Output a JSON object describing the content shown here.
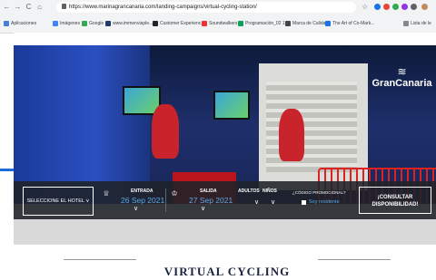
{
  "browser": {
    "url": "https://www.marinagrancanaria.com/landing-campaigns/virtual-cycling-station/",
    "nav_back": "←",
    "nav_forward": "→",
    "nav_reload": "C",
    "nav_home": "⌂",
    "star": "☆"
  },
  "bookmarks": [
    {
      "label": "Aplicaciones",
      "color": "#4a7fd8"
    },
    {
      "label": "Imágenes",
      "color": "#4285f4"
    },
    {
      "label": "Google",
      "color": "#34a853"
    },
    {
      "label": "www.immenviaple...",
      "color": "#1f3a6b"
    },
    {
      "label": "Customer Experienc...",
      "color": "#222222"
    },
    {
      "label": "Soundwalkers",
      "color": "#e33"
    },
    {
      "label": "Programación_02 1...",
      "color": "#0f9d58"
    },
    {
      "label": "Marca de Calidad",
      "color": "#444444"
    },
    {
      "label": "The Art of Co-Mark...",
      "color": "#1a73e8"
    },
    {
      "label": "Lista de le",
      "color": "#888888"
    }
  ],
  "logo": {
    "mark": "≋",
    "text": "GranCanaria"
  },
  "booking": {
    "hotel_select": "SELECCIONE EL HOTEL ∨",
    "entrada_label": "ENTRADA",
    "entrada_date": "26 Sep 2021",
    "salida_label": "SALIDA",
    "salida_date": "27 Sep 2021",
    "adultos_label": "ADULTOS",
    "ninos_label": "NIÑOS",
    "promo_label": "¿CÓDIGO PROMOCIONAL?",
    "resident_label": "Soy residente",
    "consult_button": "¡CONSULTAR DISPONIBILIDAD!",
    "chevron": "∨"
  },
  "section_title": "VIRTUAL CYCLING STATION"
}
